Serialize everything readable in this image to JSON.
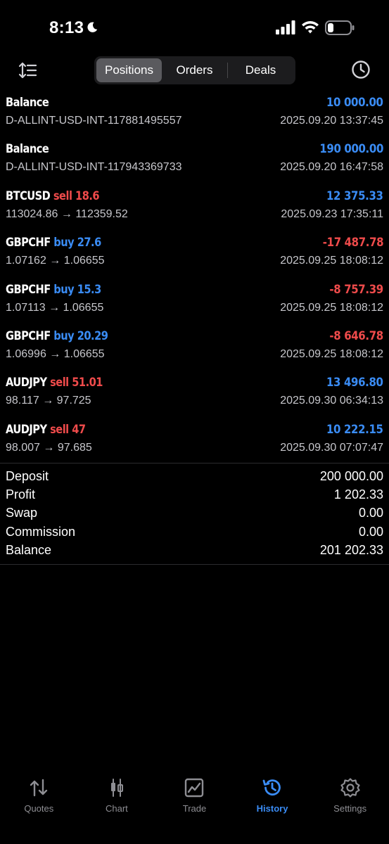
{
  "status": {
    "time": "8:13"
  },
  "toolbar": {
    "tabs": [
      {
        "label": "Positions",
        "active": true
      },
      {
        "label": "Orders",
        "active": false
      },
      {
        "label": "Deals",
        "active": false
      }
    ]
  },
  "deals": [
    {
      "symbol": "Balance",
      "side": "",
      "volume": "",
      "amount": "10 000.00",
      "amount_sign": "pos",
      "detail": "D-ALLINT-USD-INT-117881495557",
      "time": "2025.09.20 13:37:45"
    },
    {
      "symbol": "Balance",
      "side": "",
      "volume": "",
      "amount": "190 000.00",
      "amount_sign": "pos",
      "detail": "D-ALLINT-USD-INT-117943369733",
      "time": "2025.09.20 16:47:58"
    },
    {
      "symbol": "BTCUSD",
      "side": "sell",
      "volume": "18.6",
      "amount": "12 375.33",
      "amount_sign": "pos",
      "detail": "113024.86 → 112359.52",
      "time": "2025.09.23 17:35:11"
    },
    {
      "symbol": "GBPCHF",
      "side": "buy",
      "volume": "27.6",
      "amount": "-17 487.78",
      "amount_sign": "neg",
      "detail": "1.07162 → 1.06655",
      "time": "2025.09.25 18:08:12"
    },
    {
      "symbol": "GBPCHF",
      "side": "buy",
      "volume": "15.3",
      "amount": "-8 757.39",
      "amount_sign": "neg",
      "detail": "1.07113 → 1.06655",
      "time": "2025.09.25 18:08:12"
    },
    {
      "symbol": "GBPCHF",
      "side": "buy",
      "volume": "20.29",
      "amount": "-8 646.78",
      "amount_sign": "neg",
      "detail": "1.06996 → 1.06655",
      "time": "2025.09.25 18:08:12"
    },
    {
      "symbol": "AUDJPY",
      "side": "sell",
      "volume": "51.01",
      "amount": "13 496.80",
      "amount_sign": "pos",
      "detail": "98.117 → 97.725",
      "time": "2025.09.30 06:34:13"
    },
    {
      "symbol": "AUDJPY",
      "side": "sell",
      "volume": "47",
      "amount": "10 222.15",
      "amount_sign": "pos",
      "detail": "98.007 → 97.685",
      "time": "2025.09.30 07:07:47"
    }
  ],
  "summary": [
    {
      "label": "Deposit",
      "value": "200 000.00"
    },
    {
      "label": "Profit",
      "value": "1 202.33"
    },
    {
      "label": "Swap",
      "value": "0.00"
    },
    {
      "label": "Commission",
      "value": "0.00"
    },
    {
      "label": "Balance",
      "value": "201 202.33"
    }
  ],
  "tabbar": [
    {
      "label": "Quotes",
      "icon": "quotes-icon",
      "active": false
    },
    {
      "label": "Chart",
      "icon": "chart-icon",
      "active": false
    },
    {
      "label": "Trade",
      "icon": "trade-icon",
      "active": false
    },
    {
      "label": "History",
      "icon": "history-icon",
      "active": true
    },
    {
      "label": "Settings",
      "icon": "settings-icon",
      "active": false
    }
  ],
  "colors": {
    "positive": "#3a8cf5",
    "negative": "#ef4b4b",
    "active_tab": "#3a8cf5",
    "inactive_tab": "#8e8e93"
  }
}
